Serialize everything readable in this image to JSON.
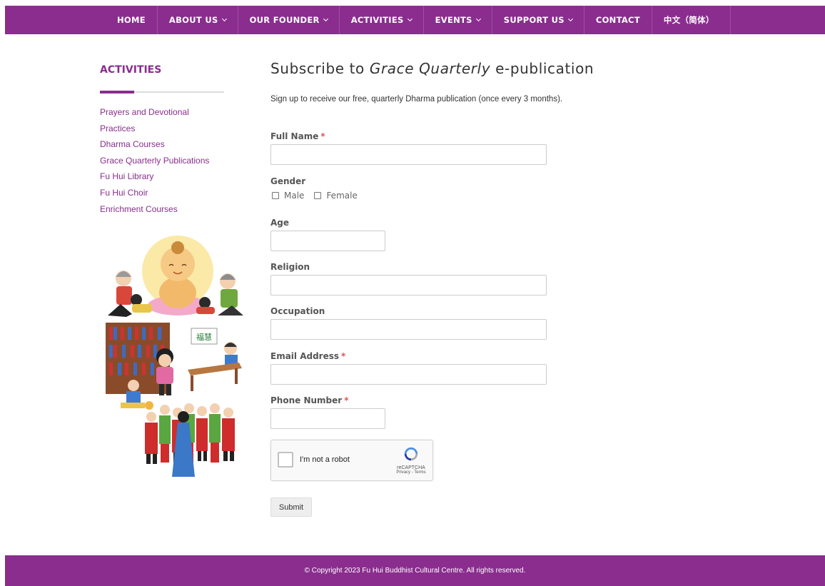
{
  "nav": {
    "items": [
      {
        "label": "HOME"
      },
      {
        "label": "ABOUT US"
      },
      {
        "label": "OUR FOUNDER"
      },
      {
        "label": "ACTIVITIES"
      },
      {
        "label": "EVENTS"
      },
      {
        "label": "SUPPORT US"
      },
      {
        "label": "CONTACT"
      },
      {
        "label": "中文（简体）"
      }
    ]
  },
  "sidebar": {
    "title": "ACTIVITIES",
    "links": [
      "Prayers and Devotional Practices",
      "Dharma Courses",
      "Grace Quarterly Publications",
      "Fu Hui Library",
      "Fu Hui Choir",
      "Enrichment Courses"
    ],
    "sign_text": "福慧"
  },
  "page": {
    "title_prefix": "Subscribe to ",
    "title_em": "Grace Quarterly",
    "title_suffix": " e-publication",
    "intro": "Sign up to receive our free, quarterly Dharma publication (once every 3 months)."
  },
  "form": {
    "full_name_label": "Full Name",
    "gender_label": "Gender",
    "gender_male": "Male",
    "gender_female": "Female",
    "age_label": "Age",
    "religion_label": "Religion",
    "occupation_label": "Occupation",
    "email_label": "Email Address",
    "phone_label": "Phone Number",
    "required_mark": "*",
    "captcha_text": "I'm not a robot",
    "captcha_brand": "reCAPTCHA",
    "captcha_terms": "Privacy - Terms",
    "submit_label": "Submit"
  },
  "footer": {
    "copyright": "© Copyright 2023 Fu Hui Buddhist Cultural Centre. All rights reserved."
  },
  "colors": {
    "brand_purple": "#8a2d8e",
    "required_red": "#e05353"
  }
}
